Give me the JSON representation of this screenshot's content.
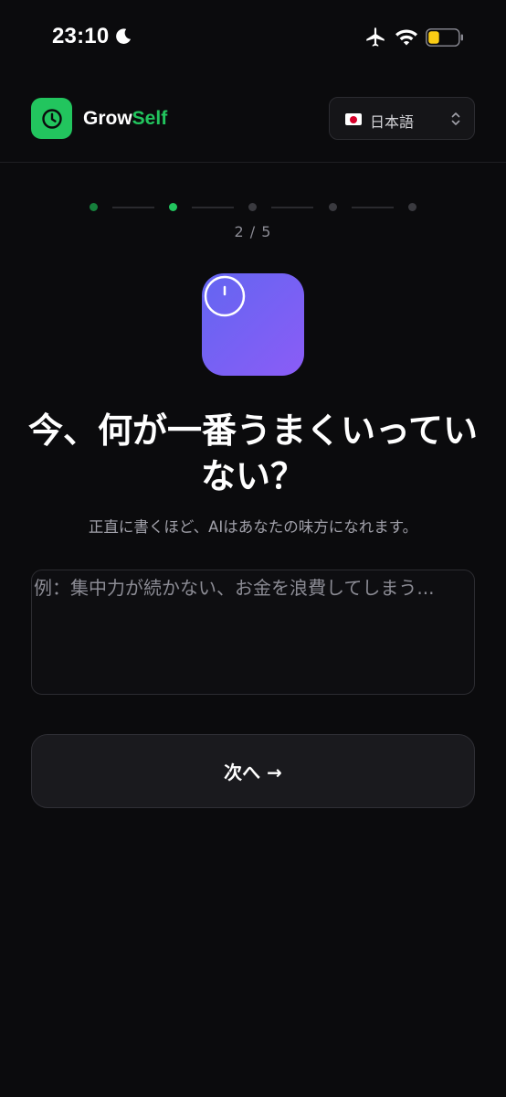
{
  "status_bar": {
    "time": "23:10",
    "icons": [
      "moon-icon",
      "airplane-icon",
      "wifi-icon",
      "battery-icon"
    ],
    "battery_color": "#facc15"
  },
  "header": {
    "logo_icon": "clock-icon",
    "brand_prefix": "Grow",
    "brand_suffix": "Self",
    "brand_accent": "#22c55e",
    "language": {
      "selected": "日本語",
      "flag_icon": "japan-flag-icon",
      "chevron_icon": "chevron-up-down-icon"
    }
  },
  "progress": {
    "current_step": 2,
    "total_steps": 5,
    "label": "2 / 5",
    "active_color": "#22c55e"
  },
  "question": {
    "icon": "clock-icon",
    "title": "今、何が一番うまくいっていない？",
    "subtitle": "正直に書くほど、AIはあなたの味方になれます。",
    "answer_value": "",
    "answer_placeholder": "例：集中力が続かない、お金を浪費してしまう..."
  },
  "actions": {
    "next_label": "次へ →"
  }
}
